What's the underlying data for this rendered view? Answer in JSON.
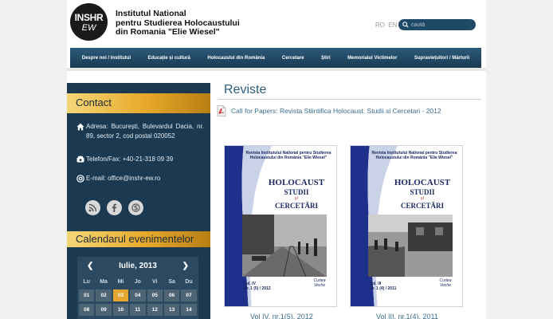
{
  "header": {
    "logo": {
      "line1": "INSHR",
      "line2": "EW"
    },
    "institute": {
      "line1": "Institutul National",
      "line2": "pentru Studierea Holocaustului",
      "line3": "din Romania \"Elie Wiesel\""
    },
    "languages": [
      "RO",
      "EN"
    ],
    "search": {
      "placeholder": "caută"
    }
  },
  "nav": {
    "items": [
      "Despre noi / Institutul",
      "Educație și cultură",
      "Holocaustul din România",
      "Cercetare",
      "Știri",
      "Memorialul Victimelor",
      "Supraviețuitori / Mărturii"
    ]
  },
  "sidebar": {
    "contact": {
      "heading": "Contact",
      "address": "Adresa: București, Bulevardul Dacia, nr. 89, sector 2, cod postal 020052",
      "phone": "Telefon/Fax: +40-21-318 09 39",
      "email": "E-mail: office@inshr-ew.ro"
    },
    "social": [
      "rss-icon",
      "facebook-icon",
      "skype-icon"
    ],
    "calendar": {
      "heading": "Calendarul evenimentelor",
      "prev": "❮",
      "next": "❯",
      "month": "Iulie, 2013",
      "days": [
        "Lu",
        "Ma",
        "Mi",
        "Jo",
        "Vi",
        "Sa",
        "Du"
      ],
      "weeks": [
        [
          "01",
          "02",
          "03",
          "04",
          "05",
          "06",
          "07"
        ],
        [
          "08",
          "09",
          "10",
          "11",
          "12",
          "13",
          "14"
        ]
      ],
      "today": "03"
    }
  },
  "main": {
    "title": "Reviste",
    "cfp": "Call for Papers: Revista Stiintifica Holocaust. Studii si Cercetari - 2012",
    "covers": [
      {
        "header": "Revista Institutului Național pentru Studierea Holocaustului din România \"Elie Wiesel\"",
        "title1": "HOLOCAUST",
        "title2": "STUDII",
        "and": "și",
        "title3": "CERCETĂRI",
        "vol": "Vol. IV",
        "nr": "Nr. 1 (5) / 2012",
        "publisher": "Curtea Veche",
        "caption": "Vol IV, nr.1(5), 2012"
      },
      {
        "header": "Revista Institutului Național pentru Studierea Holocaustului din România \"Elie Wiesel\"",
        "title1": "HOLOCAUST",
        "title2": "STUDII",
        "and": "și",
        "title3": "CERCETĂRI",
        "vol": "Vol. III",
        "nr": "Nr. 1 (4) / 2011",
        "publisher": "Curtea Veche",
        "caption": "Vol III, nr.1(4), 2011"
      }
    ]
  },
  "colors": {
    "nav": "#2d5a7a",
    "sidebar": "#1b3a52",
    "accent": "#e7a829",
    "link": "#3b6c8e"
  }
}
